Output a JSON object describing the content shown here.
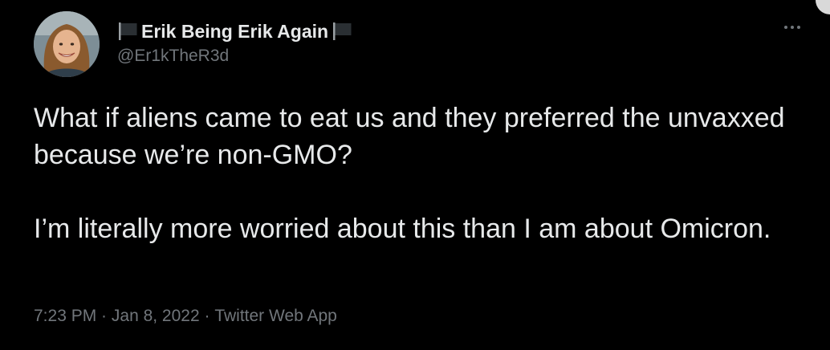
{
  "author": {
    "display_name": "Erik Being Erik Again",
    "handle": "@Er1kTheR3d",
    "name_prefix_icon": "black-flag-icon",
    "name_suffix_icon": "black-flag-icon"
  },
  "tweet": {
    "paragraphs": [
      "What if aliens came to eat us and they preferred the unvaxxed because we’re non-GMO?",
      "I’m literally more worried about this than I am about Omicron."
    ]
  },
  "meta": {
    "time": "7:23 PM",
    "separator": " · ",
    "date": "Jan 8, 2022",
    "source": "Twitter Web App"
  },
  "icons": {
    "more": "more-options-icon"
  },
  "colors": {
    "background": "#000000",
    "primary_text": "#e7e9ea",
    "secondary_text": "#71767b"
  }
}
